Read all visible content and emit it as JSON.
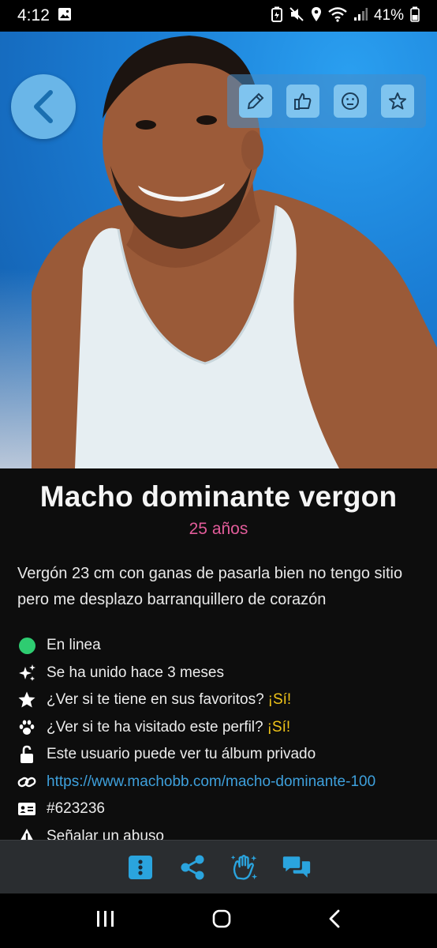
{
  "status_bar": {
    "time": "4:12",
    "battery_percent": "41%",
    "icons": [
      "gallery-icon",
      "battery-saver-icon",
      "mute-icon",
      "location-icon",
      "wifi-icon",
      "signal-icon",
      "battery-icon"
    ]
  },
  "photo": {
    "back_icon": "chevron-left-icon",
    "actions": [
      {
        "name": "edit",
        "icon": "pencil-icon"
      },
      {
        "name": "like",
        "icon": "thumbs-up-icon"
      },
      {
        "name": "react",
        "icon": "neutral-face-icon"
      },
      {
        "name": "favorite",
        "icon": "star-icon"
      }
    ],
    "gallery_dots": [
      "active",
      "inactive",
      "locked",
      "locked",
      "locked"
    ]
  },
  "profile": {
    "title": "Macho dominante vergon",
    "age": "25 años",
    "bio": "Vergón 23 cm con ganas de pasarla bien no tengo sitio pero me desplazo barranquillero de corazón"
  },
  "info": {
    "online": "En linea",
    "joined": "Se ha unido hace 3 meses",
    "favorites_question": "¿Ver si te tiene en sus favoritos?",
    "favorites_answer": "¡Sí!",
    "visited_question": "¿Ver si te ha visitado este perfil?",
    "visited_answer": "¡Sí!",
    "private_album": "Este usuario puede ver tu álbum privado",
    "profile_url": "https://www.machobb.com/macho-dominante-100",
    "profile_id": "#623236",
    "report": "Señalar un abuso"
  },
  "bottom_bar": {
    "buttons": [
      "more-options-icon",
      "share-icon",
      "wave-hand-icon",
      "chat-bubbles-icon"
    ]
  },
  "colors": {
    "accent_blue": "#3ea0dc",
    "age_pink": "#e25c9a",
    "yes_yellow": "#f0c419",
    "online_green": "#2ecc71"
  }
}
